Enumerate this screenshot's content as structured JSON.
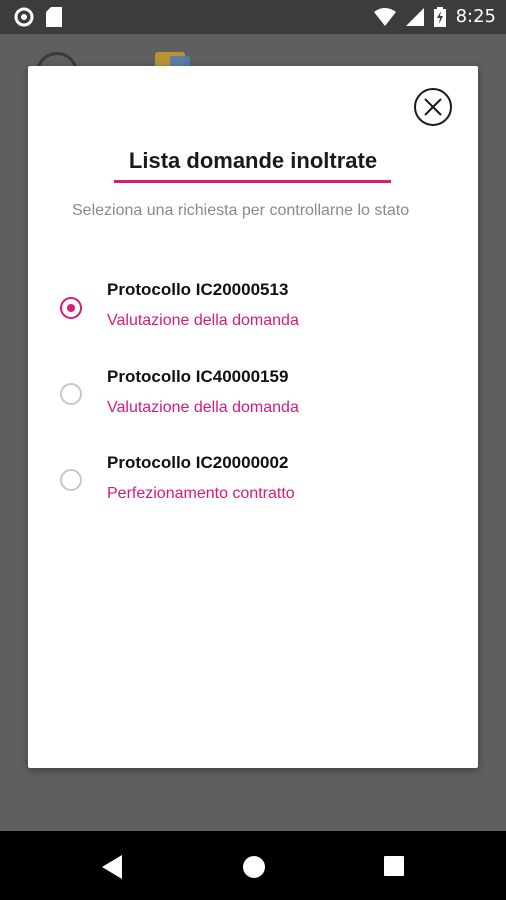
{
  "status_bar": {
    "time": "8:25",
    "left_icons": [
      "circle-notification-icon",
      "sd-card-icon"
    ],
    "right_icons": [
      "wifi-icon",
      "signal-icon",
      "battery-charging-icon"
    ]
  },
  "dialog": {
    "title": "Lista domande inoltrate",
    "subtitle": "Seleziona una richiesta per controllarne lo stato",
    "close_icon": "close-icon",
    "items": [
      {
        "title": "Protocollo IC20000513",
        "status": "Valutazione della domanda",
        "selected": true
      },
      {
        "title": "Protocollo IC40000159",
        "status": "Valutazione della domanda",
        "selected": false
      },
      {
        "title": "Protocollo IC20000002",
        "status": "Perfezionamento contratto",
        "selected": false
      }
    ]
  },
  "nav_bar": {
    "icons": [
      "back-icon",
      "home-icon",
      "recents-icon"
    ]
  },
  "colors": {
    "accent": "#d81b78",
    "status_bar": "#3c3c3c",
    "scrim": "#636363"
  }
}
